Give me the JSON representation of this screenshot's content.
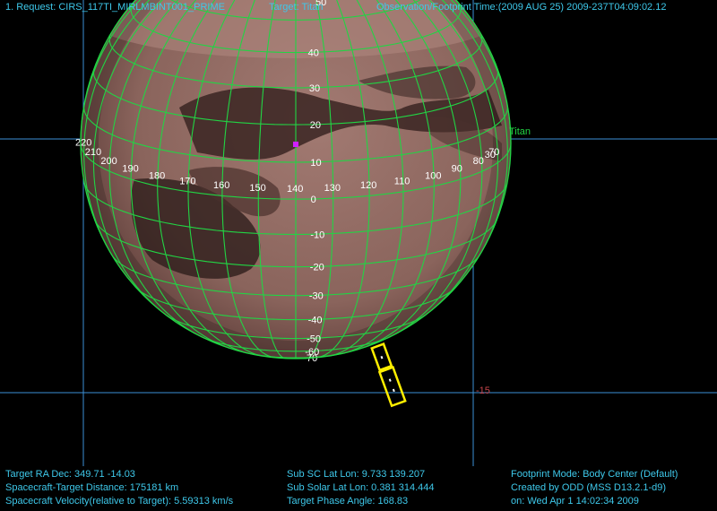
{
  "header": {
    "request": "1. Request: CIRS_117TI_MIRLMBINT001_PRIME",
    "target": "Target: Titan",
    "obs_time": "Observation/Footprint Time:(2009 AUG 25) 2009-237T04:09:02.12"
  },
  "view": {
    "target_name": "Titan",
    "reticle_value": "-15",
    "top_label": "50"
  },
  "latitudes": [
    "40",
    "30",
    "20",
    "10",
    "0",
    "-10",
    "-20",
    "-30",
    "-40",
    "-50",
    "-60",
    "-70"
  ],
  "longitudes": [
    "220",
    "210",
    "200",
    "190",
    "180",
    "170",
    "160",
    "150",
    "140",
    "130",
    "120",
    "110",
    "100",
    "90",
    "80",
    "70",
    "30"
  ],
  "footer": {
    "left": [
      "Target RA Dec: 349.71  -14.03",
      "Spacecraft-Target Distance:  175181 km",
      "Spacecraft Velocity(relative to Target): 5.59313 km/s"
    ],
    "middle": [
      "Sub SC Lat Lon:  9.733  139.207",
      "Sub Solar Lat Lon:  0.381  314.444",
      "Target Phase Angle: 168.83"
    ],
    "right": [
      "Footprint Mode: Body Center (Default)",
      "Created by ODD (MSS D13.2.1-d9)",
      "on: Wed Apr  1 14:02:34 2009"
    ]
  },
  "colors": {
    "grid": "#22d444",
    "crosshair": "#3c8fd6",
    "footprint": "#ffee00",
    "surface": "#8e6a62",
    "hud_cyan": "#3ec8ea",
    "reticle": "#c4444a"
  }
}
